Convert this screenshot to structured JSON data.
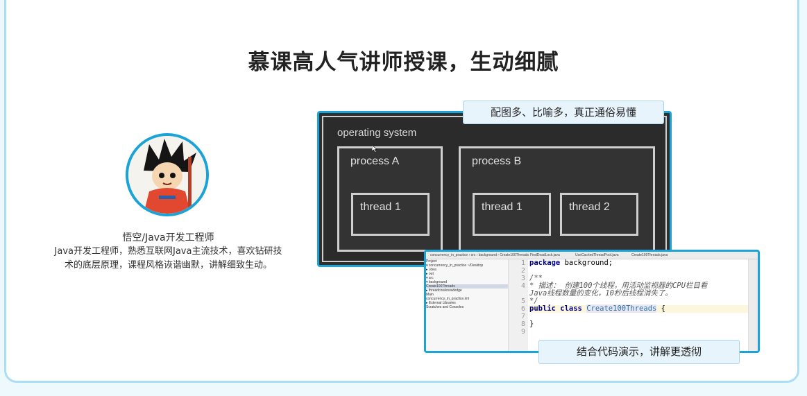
{
  "headline": "慕课高人气讲师授课，生动细腻",
  "teacher": {
    "name": "悟空/Java开发工程师",
    "desc_line1": "Java开发工程师，熟悉互联网Java主流技术，喜欢钻研技",
    "desc_line2": "术的底层原理，课程风格诙谐幽默，讲解细致生动。"
  },
  "diagram": {
    "os_label": "operating system",
    "process_a": "process A",
    "process_b": "process B",
    "thread_a1": "thread 1",
    "thread_b1": "thread 1",
    "thread_b2": "thread 2",
    "badge": "配图多、比喻多，真正通俗易懂"
  },
  "ide": {
    "topbar_path": "concurrency_in_practice › src › background › Create100Threads",
    "tabs": [
      "FindDeadLock.java",
      "UseCachedThreadPool.java",
      "Create100Threads.java"
    ],
    "tree": [
      "Project",
      "▾ concurrency_in_practice ~/Desktop",
      "  ▸ .idea",
      "  ▸ out",
      "  ▾ src",
      "    ▾ background",
      "        Create100Threads",
      "    ▸ threadcoreknowledge",
      "      Main",
      "  concurrency_in_practice.iml",
      "▸ External Libraries",
      "  Scratches and Consoles"
    ],
    "line_numbers": [
      "1",
      "2",
      "3",
      "4",
      "",
      "5",
      "6",
      "7",
      "8",
      "9"
    ],
    "code": {
      "l1_kw": "package",
      "l1_rest": " background;",
      "l3": "/**",
      "l4a": " * 描述：     创建100个线程，用活动监视器的CPU栏目看",
      "l4b": " Java线程数量的变化，10秒后线程消失了。",
      "l5": " */",
      "l6_kw1": "public",
      "l6_kw2": "class",
      "l6_cls": "Create100Threads",
      "l6_rest": " {",
      "l8": "}"
    },
    "badge": "结合代码演示，讲解更透彻"
  }
}
